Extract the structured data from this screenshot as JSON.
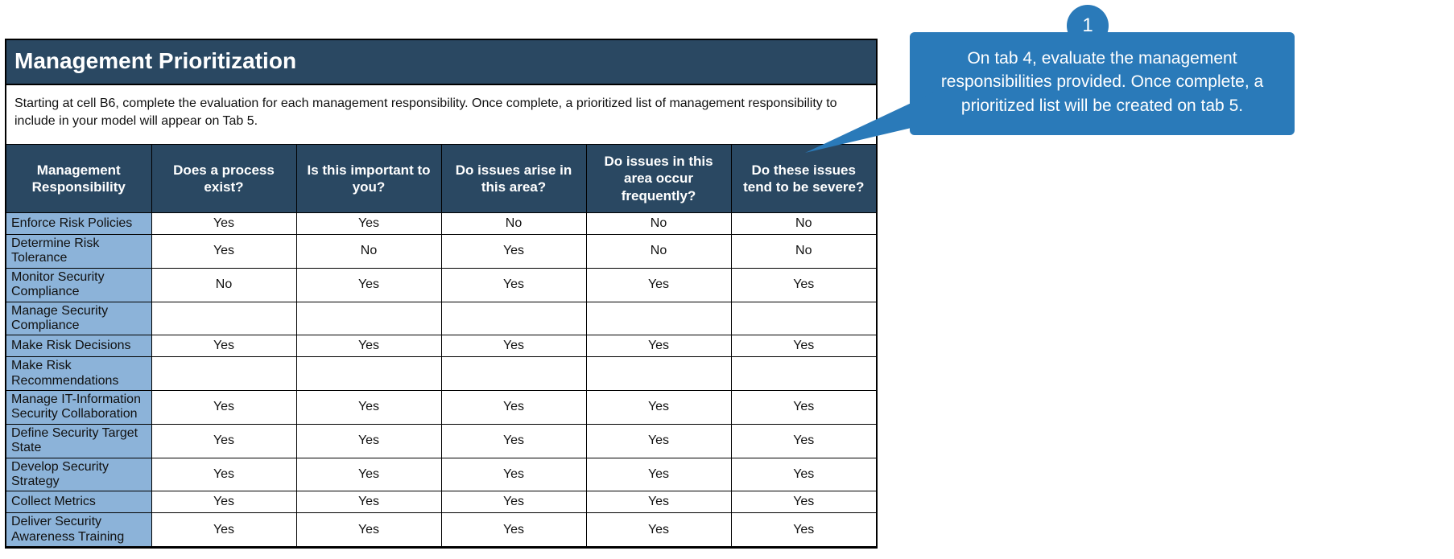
{
  "title": "Management Prioritization",
  "instructions": "Starting at cell B6, complete the evaluation for each management responsibility. Once complete, a prioritized list of management responsibility to include in your model will appear on Tab 5.",
  "columns": [
    "Management Responsibility",
    "Does a process exist?",
    "Is this important to you?",
    "Do issues arise in this area?",
    "Do issues in this area occur frequently?",
    "Do these issues tend to be severe?"
  ],
  "rows": [
    {
      "name": "Enforce Risk Policies",
      "values": [
        "Yes",
        "Yes",
        "No",
        "No",
        "No"
      ]
    },
    {
      "name": "Determine Risk Tolerance",
      "values": [
        "Yes",
        "No",
        "Yes",
        "No",
        "No"
      ]
    },
    {
      "name": "Monitor Security Compliance",
      "values": [
        "No",
        "Yes",
        "Yes",
        "Yes",
        "Yes"
      ]
    },
    {
      "name": "Manage Security Compliance",
      "values": [
        "",
        "",
        "",
        "",
        ""
      ]
    },
    {
      "name": "Make Risk Decisions",
      "values": [
        "Yes",
        "Yes",
        "Yes",
        "Yes",
        "Yes"
      ]
    },
    {
      "name": "Make Risk Recommendations",
      "values": [
        "",
        "",
        "",
        "",
        ""
      ]
    },
    {
      "name": "Manage IT-Information Security Collaboration",
      "values": [
        "Yes",
        "Yes",
        "Yes",
        "Yes",
        "Yes"
      ]
    },
    {
      "name": "Define Security Target State",
      "values": [
        "Yes",
        "Yes",
        "Yes",
        "Yes",
        "Yes"
      ]
    },
    {
      "name": "Develop Security Strategy",
      "values": [
        "Yes",
        "Yes",
        "Yes",
        "Yes",
        "Yes"
      ]
    },
    {
      "name": "Collect Metrics",
      "values": [
        "Yes",
        "Yes",
        "Yes",
        "Yes",
        "Yes"
      ]
    },
    {
      "name": "Deliver Security Awareness Training",
      "values": [
        "Yes",
        "Yes",
        "Yes",
        "Yes",
        "Yes"
      ]
    }
  ],
  "callout": {
    "number": "1",
    "text": "On tab 4, evaluate the management responsibilities provided. Once complete, a prioritized list will be created on tab 5."
  }
}
